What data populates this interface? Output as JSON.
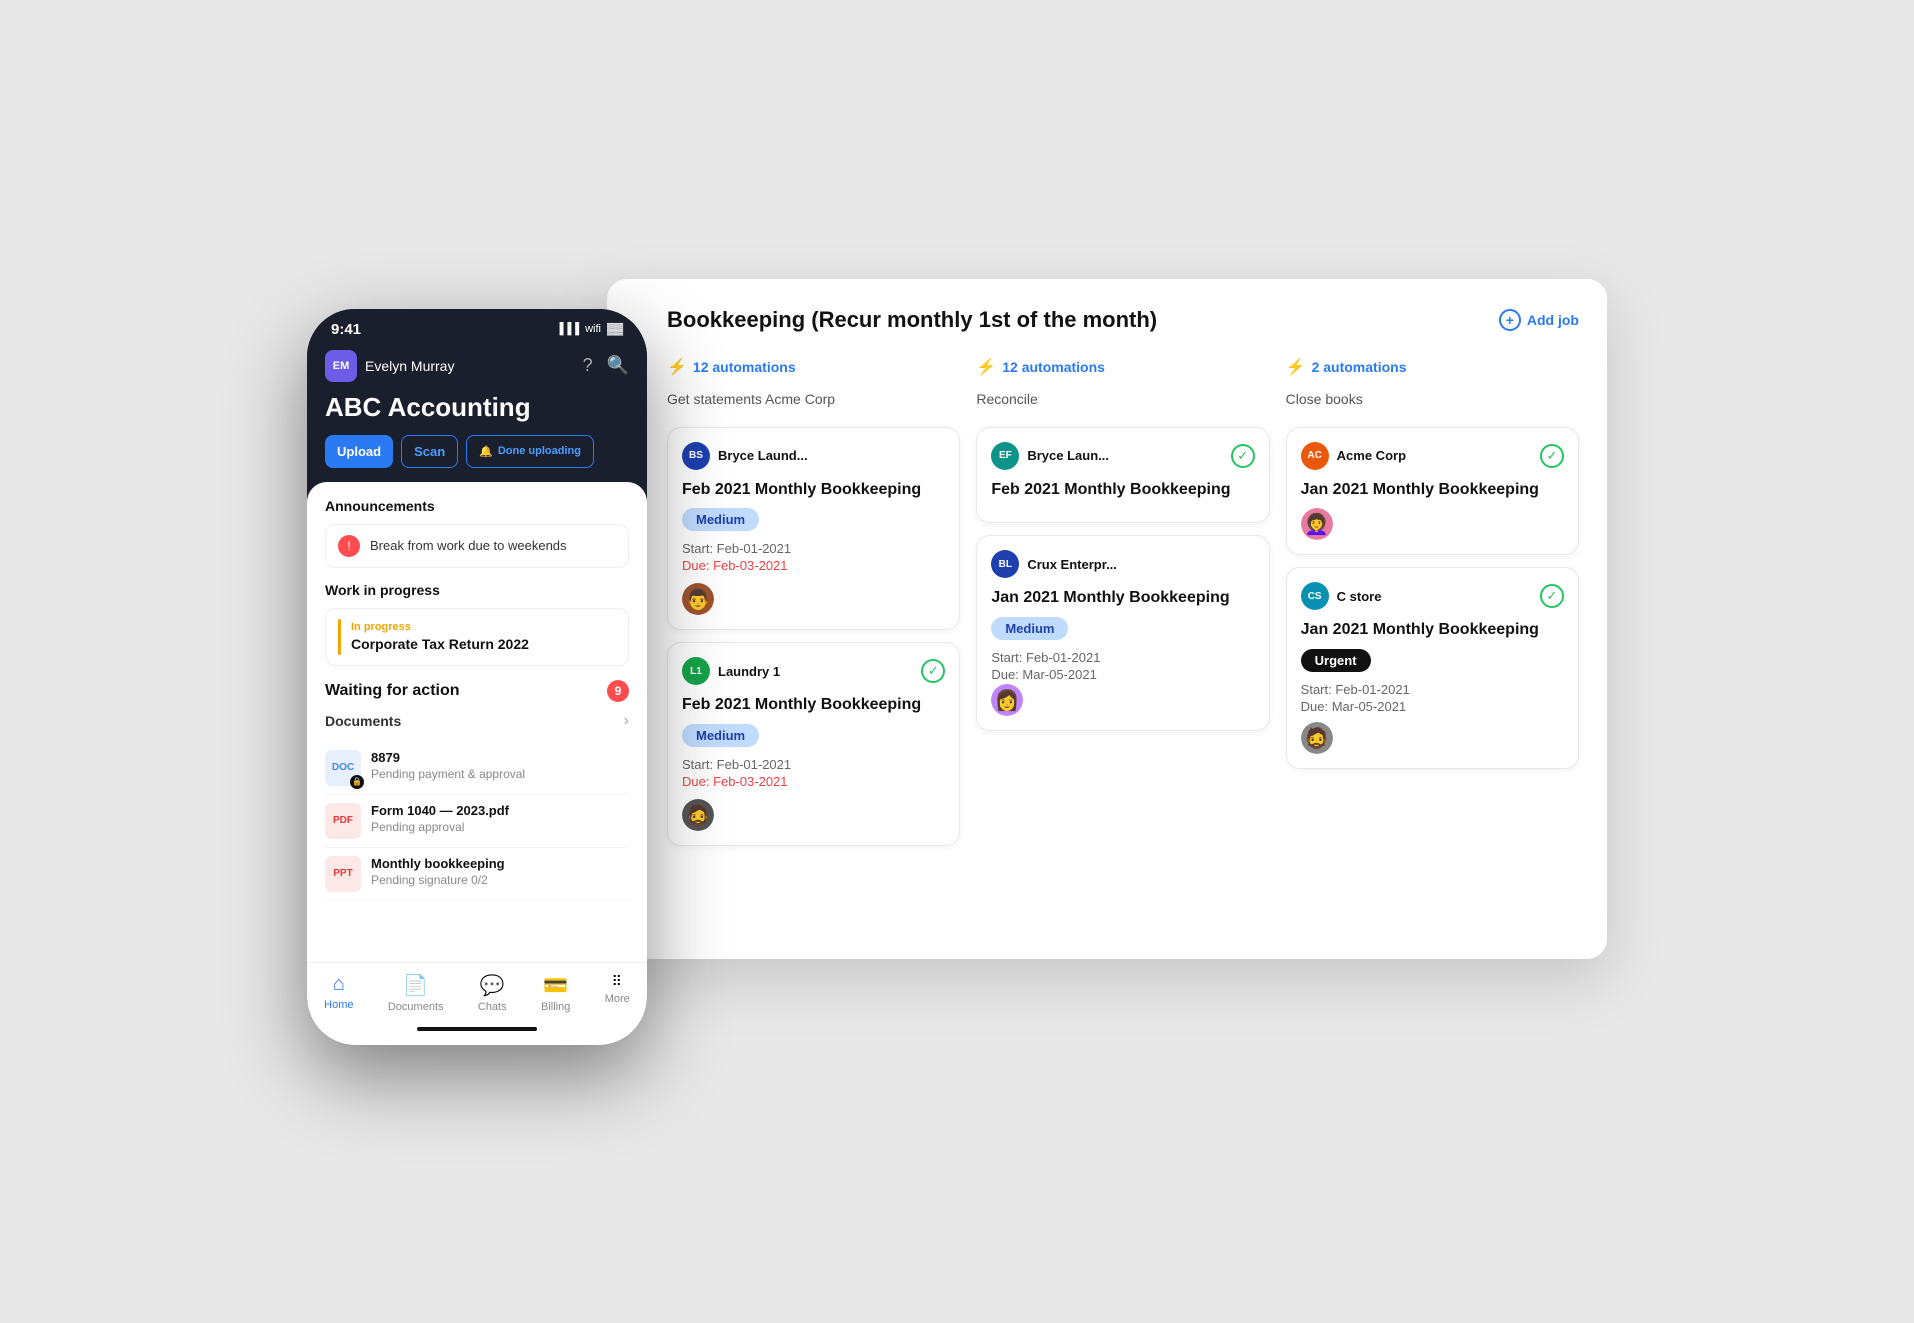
{
  "phone": {
    "time": "9:41",
    "user": {
      "initials": "EM",
      "name": "Evelyn Murray",
      "avatar_color": "#6c5ce7"
    },
    "company": "ABC Accounting",
    "buttons": {
      "upload": "Upload",
      "scan": "Scan",
      "done": "Done uploading"
    },
    "announcements": {
      "title": "Announcements",
      "item": "Break from work due to weekends"
    },
    "work_in_progress": {
      "title": "Work in progress",
      "status": "In progress",
      "job": "Corporate Tax Return 2022"
    },
    "waiting_for_action": {
      "title": "Waiting for action",
      "count": "9",
      "documents_label": "Documents",
      "docs": [
        {
          "type": "doc",
          "name": "8879",
          "status": "Pending payment & approval"
        },
        {
          "type": "pdf",
          "name": "Form 1040 — 2023.pdf",
          "status": "Pending approval"
        },
        {
          "type": "ppt",
          "name": "Monthly bookkeeping",
          "status": "Pending signature 0/2"
        }
      ]
    },
    "nav": [
      {
        "label": "Home",
        "active": true,
        "icon": "⌂"
      },
      {
        "label": "Documents",
        "active": false,
        "icon": "📄"
      },
      {
        "label": "Chats",
        "active": false,
        "icon": "💬"
      },
      {
        "label": "Billing",
        "active": false,
        "icon": "💳"
      },
      {
        "label": "More",
        "active": false,
        "icon": "⠿"
      }
    ]
  },
  "panel": {
    "title": "Bookkeeping (Recur monthly 1st of the month)",
    "add_job": "Add job",
    "columns": [
      {
        "automations": "12 automations",
        "subtitle": "Get statements Acme Corp",
        "cards": [
          {
            "client_initials": "BS",
            "client_name": "Bryce Laund...",
            "client_color": "#1e40af",
            "completed": false,
            "job_title": "Feb 2021 Monthly Bookkeeping",
            "priority": "Medium",
            "priority_type": "medium",
            "start": "Start: Feb-01-2021",
            "due": "Due: Feb-03-2021",
            "due_overdue": true,
            "assignee": "👨"
          },
          {
            "client_initials": "L1",
            "client_name": "Laundry 1",
            "client_color": "#16a34a",
            "completed": true,
            "job_title": "Feb 2021 Monthly Bookkeeping",
            "priority": "Medium",
            "priority_type": "medium",
            "start": "Start: Feb-01-2021",
            "due": "Due: Feb-03-2021",
            "due_overdue": true,
            "assignee": "🧔"
          }
        ]
      },
      {
        "automations": "12 automations",
        "subtitle": "Reconcile",
        "cards": [
          {
            "client_initials": "EF",
            "client_name": "Bryce Laun...",
            "client_color": "#0d9488",
            "completed": true,
            "job_title": "Feb 2021 Monthly Bookkeeping",
            "priority": null,
            "priority_type": null,
            "start": null,
            "due": null,
            "due_overdue": false,
            "assignee": null
          },
          {
            "client_initials": "BL",
            "client_name": "Crux Enterpr...",
            "client_color": "#1e40af",
            "completed": false,
            "job_title": "Jan 2021 Monthly Bookkeeping",
            "priority": "Medium",
            "priority_type": "medium",
            "start": "Start: Feb-01-2021",
            "due": "Due: Mar-05-2021",
            "due_overdue": false,
            "assignee": "👩"
          }
        ]
      },
      {
        "automations": "2 automations",
        "subtitle": "Close books",
        "cards": [
          {
            "client_initials": "AC",
            "client_name": "Acme Corp",
            "client_color": "#ea580c",
            "completed": true,
            "job_title": "Jan 2021 Monthly Bookkeeping",
            "priority": null,
            "priority_type": null,
            "start": null,
            "due": null,
            "due_overdue": false,
            "assignee": "👩‍🦱"
          },
          {
            "client_initials": "CS",
            "client_name": "C store",
            "client_color": "#0891b2",
            "completed": true,
            "job_title": "Jan 2021 Monthly Bookkeeping",
            "priority": "Urgent",
            "priority_type": "urgent",
            "start": "Start: Feb-01-2021",
            "due": "Due: Mar-05-2021",
            "due_overdue": false,
            "assignee": "🧔"
          }
        ]
      }
    ]
  }
}
